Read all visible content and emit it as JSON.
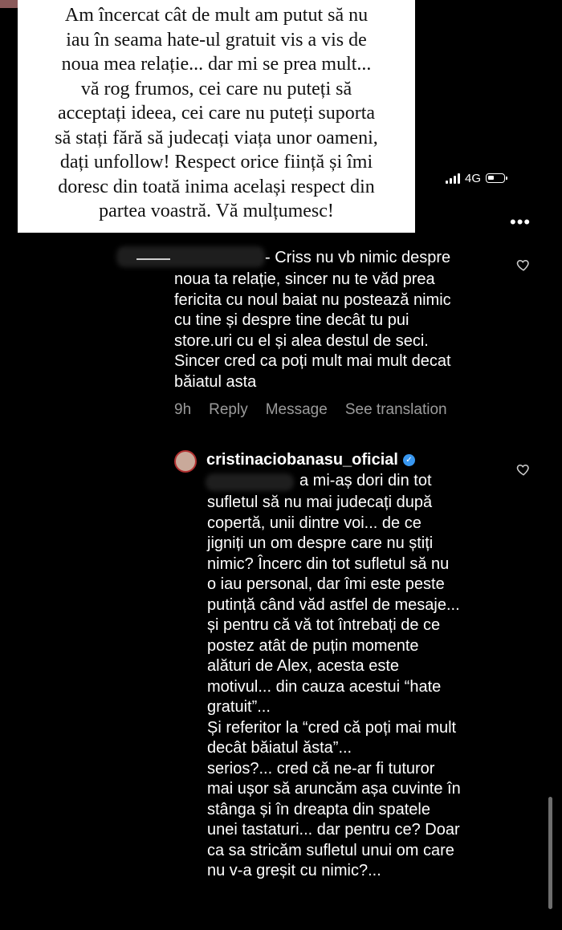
{
  "caption": {
    "lines": [
      "Am încercat cât de mult am putut să nu",
      "iau în seama hate-ul gratuit vis a vis de",
      "noua mea relație... dar mi se prea mult...",
      "vă rog frumos, cei care nu puteți să",
      "acceptați ideea, cei care nu puteți suporta",
      "să stați fără să judecați viața unor oameni,",
      "dați unfollow! Respect orice ființă și îmi",
      "doresc din toată inima același respect din",
      "partea voastră. Vă mulțumesc!"
    ]
  },
  "status_bar": {
    "network": "4G"
  },
  "comment": {
    "username_suffix": "- Criss nu vb nimic despre",
    "lines": [
      "noua ta relație, sincer nu te văd prea",
      "fericita cu noul baiat nu postează nimic",
      "cu tine și despre tine decât tu pui",
      "store.uri cu el și alea destul de seci.",
      "Sincer cred ca poți mult mai mult decat",
      "băiatul asta"
    ],
    "time": "9h",
    "reply_label": "Reply",
    "message_label": "Message",
    "translate_label": "See translation"
  },
  "reply": {
    "username": "cristinaciobanasu_oficial",
    "mention_suffix": "a mi-aș dori din tot",
    "lines": [
      "sufletul să nu mai judecați după",
      "copertă, unii dintre voi... de ce",
      "jigniți un om despre care nu știți",
      "nimic? Încerc din tot sufletul să nu",
      "o iau personal, dar îmi este peste",
      "putință când văd astfel de mesaje...",
      "și pentru că vă tot întrebați de ce",
      "postez atât de puțin momente",
      "alături de Alex, acesta este",
      "motivul... din cauza acestui “hate",
      "gratuit”...",
      "Și referitor la “cred că poți mai mult",
      "decât băiatul ăsta”...",
      "serios?... cred că ne-ar fi tuturor",
      "mai ușor să aruncăm așa cuvinte în",
      "stânga și în dreapta din spatele",
      "unei tastaturi... dar pentru ce? Doar",
      "ca sa stricăm sufletul unui om care",
      "nu v-a greșit cu nimic?..."
    ]
  },
  "colors": {
    "background": "#000000",
    "muted": "#9b9b9b",
    "verified": "#3897f0"
  }
}
